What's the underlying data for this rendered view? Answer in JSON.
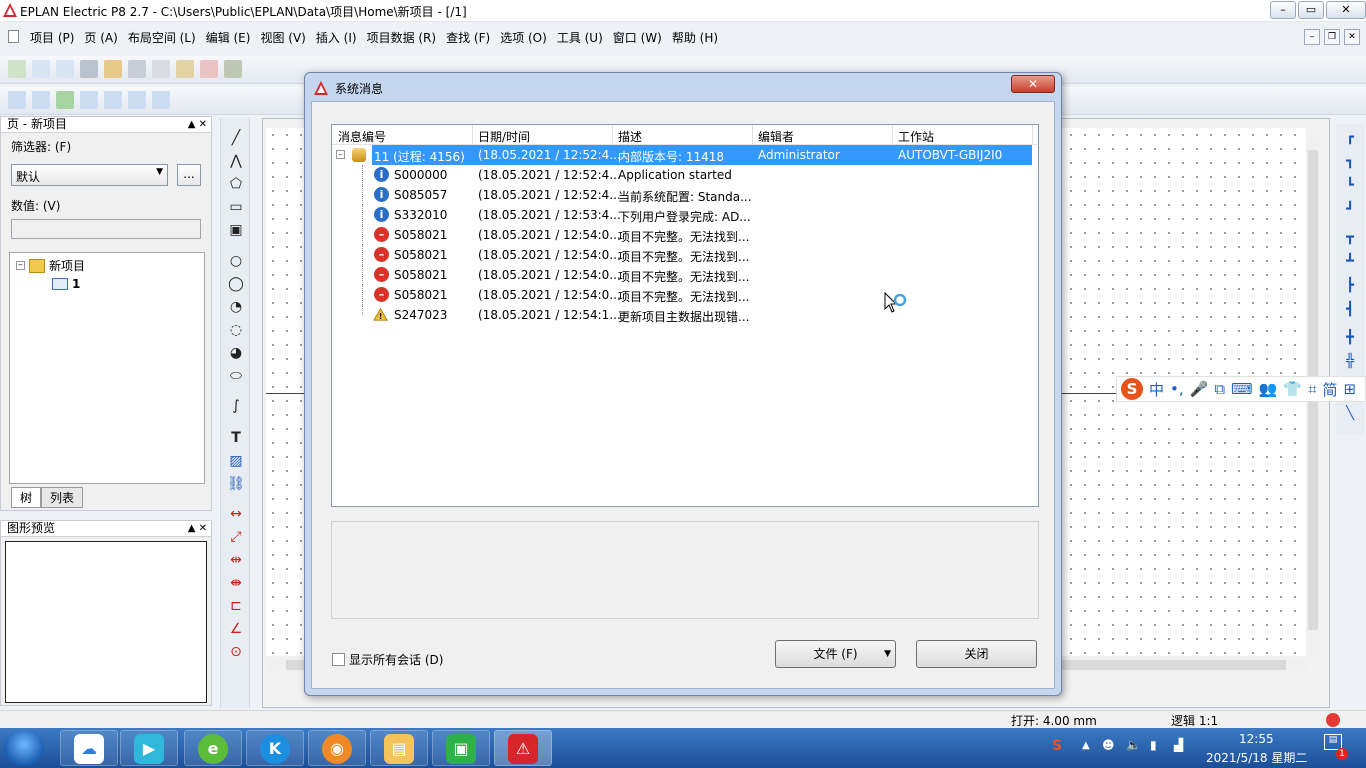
{
  "window": {
    "title": "EPLAN Electric P8 2.7 - C:\\Users\\Public\\EPLAN\\Data\\项目\\Home\\新项目 - [/1]",
    "buttons": [
      "–",
      "▭",
      "✕"
    ]
  },
  "menu": {
    "items": [
      "项目 (P)",
      "页 (A)",
      "布局空间 (L)",
      "编辑 (E)",
      "视图 (V)",
      "插入 (I)",
      "项目数据 (R)",
      "查找 (F)",
      "选项 (O)",
      "工具 (U)",
      "窗口 (W)",
      "帮助 (H)"
    ]
  },
  "left_panel": {
    "title": "页 - 新项目",
    "filter_label": "筛选器: (F)",
    "filter_value": "默认",
    "dots_button": "...",
    "value_label": "数值: (V)",
    "tree": {
      "root": "新项目",
      "page": "1"
    },
    "tabs": [
      "树",
      "列表"
    ]
  },
  "preview_panel": {
    "title": "图形预览"
  },
  "ime": {
    "logo": "S",
    "items": [
      "中",
      "•,",
      "🎤",
      "⧉",
      "⌨",
      "👥",
      "👕",
      "⌗",
      "简",
      "⊞"
    ]
  },
  "dialog": {
    "title": "系统消息",
    "close": "✕",
    "columns": [
      "消息编号",
      "日期/时间",
      "描述",
      "编辑者",
      "工作站"
    ],
    "selected_row": {
      "id": "11 (过程: 4156)",
      "datetime": "(18.05.2021 / 12:52:4...",
      "description": "内部版本号: 11418",
      "editor": "Administrator",
      "workstation": "AUTOBVT-GBIJ2I0"
    },
    "rows": [
      {
        "type": "info",
        "id": "S000000",
        "datetime": "(18.05.2021 / 12:52:4...",
        "description": "Application started"
      },
      {
        "type": "info",
        "id": "S085057",
        "datetime": "(18.05.2021 / 12:52:4...",
        "description": "当前系统配置: Standa..."
      },
      {
        "type": "info",
        "id": "S332010",
        "datetime": "(18.05.2021 / 12:53:4...",
        "description": "下列用户登录完成: AD..."
      },
      {
        "type": "error",
        "id": "S058021",
        "datetime": "(18.05.2021 / 12:54:0...",
        "description": "项目不完整。无法找到..."
      },
      {
        "type": "error",
        "id": "S058021",
        "datetime": "(18.05.2021 / 12:54:0...",
        "description": "项目不完整。无法找到..."
      },
      {
        "type": "error",
        "id": "S058021",
        "datetime": "(18.05.2021 / 12:54:0...",
        "description": "项目不完整。无法找到..."
      },
      {
        "type": "error",
        "id": "S058021",
        "datetime": "(18.05.2021 / 12:54:0...",
        "description": "项目不完整。无法找到..."
      },
      {
        "type": "warning",
        "id": "S247023",
        "datetime": "(18.05.2021 / 12:54:1...",
        "description": "更新项目主数据出现错..."
      }
    ],
    "show_all_sessions": "显示所有会话 (D)",
    "file_button": "文件 (F)",
    "close_button": "关闭"
  },
  "status": {
    "open": "打开: 4.00 mm",
    "logic": "逻辑 1:1"
  },
  "taskbar": {
    "time": "12:55",
    "date": "2021/5/18 星期二",
    "ime_tray": "S",
    "notif_count": "1"
  }
}
